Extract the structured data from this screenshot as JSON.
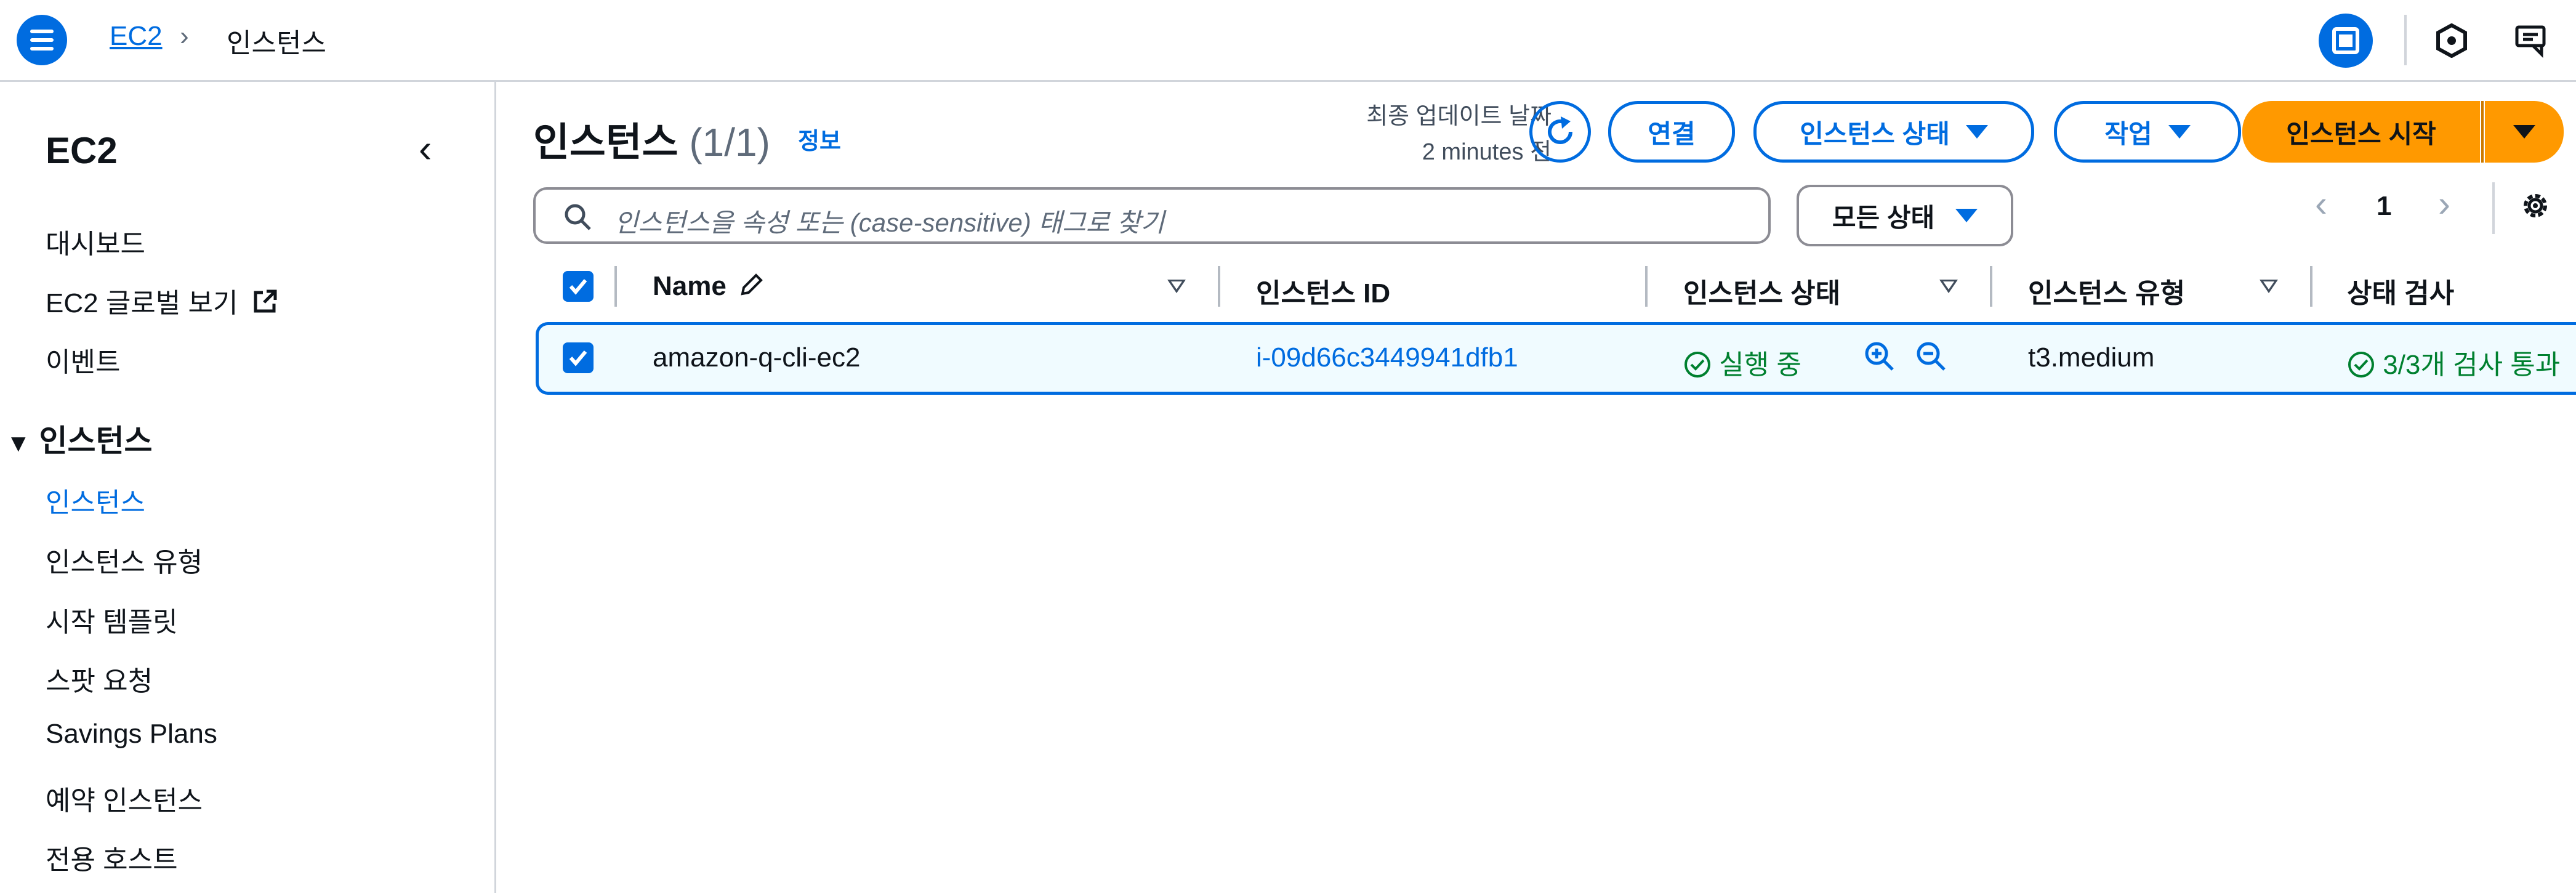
{
  "breadcrumb": {
    "root": "EC2",
    "current": "인스턴스"
  },
  "sidebar": {
    "title": "EC2",
    "items": [
      "대시보드",
      "EC2 글로벌 보기",
      "이벤트"
    ],
    "section": "인스턴스",
    "section_items": [
      "인스턴스",
      "인스턴스 유형",
      "시작 템플릿",
      "스팟 요청",
      "Savings Plans",
      "예약 인스턴스",
      "전용 호스트"
    ],
    "active_item": "인스턴스"
  },
  "main": {
    "title": "인스턴스",
    "count": "(1/1)",
    "info_link": "정보",
    "last_updated_label": "최종 업데이트 날짜",
    "last_updated_value": "2 minutes 전",
    "buttons": {
      "connect": "연결",
      "instance_state": "인스턴스 상태",
      "actions": "작업",
      "launch": "인스턴스 시작"
    },
    "search_placeholder": "인스턴스을 속성 또는 (case-sensitive) 태그로 찾기",
    "state_filter": "모든 상태",
    "page_number": "1"
  },
  "table": {
    "columns": [
      "Name",
      "인스턴스 ID",
      "인스턴스 상태",
      "인스턴스 유형",
      "상태 검사"
    ],
    "rows": [
      {
        "name": "amazon-q-cli-ec2",
        "instance_id": "i-09d66c3449941dfb1",
        "state": "실행 중",
        "type": "t3.medium",
        "status_check": "3/3개 검사 통과"
      }
    ]
  },
  "colors": {
    "accent": "#006ce0",
    "primary_button": "#ff9900",
    "success": "#00802f"
  }
}
